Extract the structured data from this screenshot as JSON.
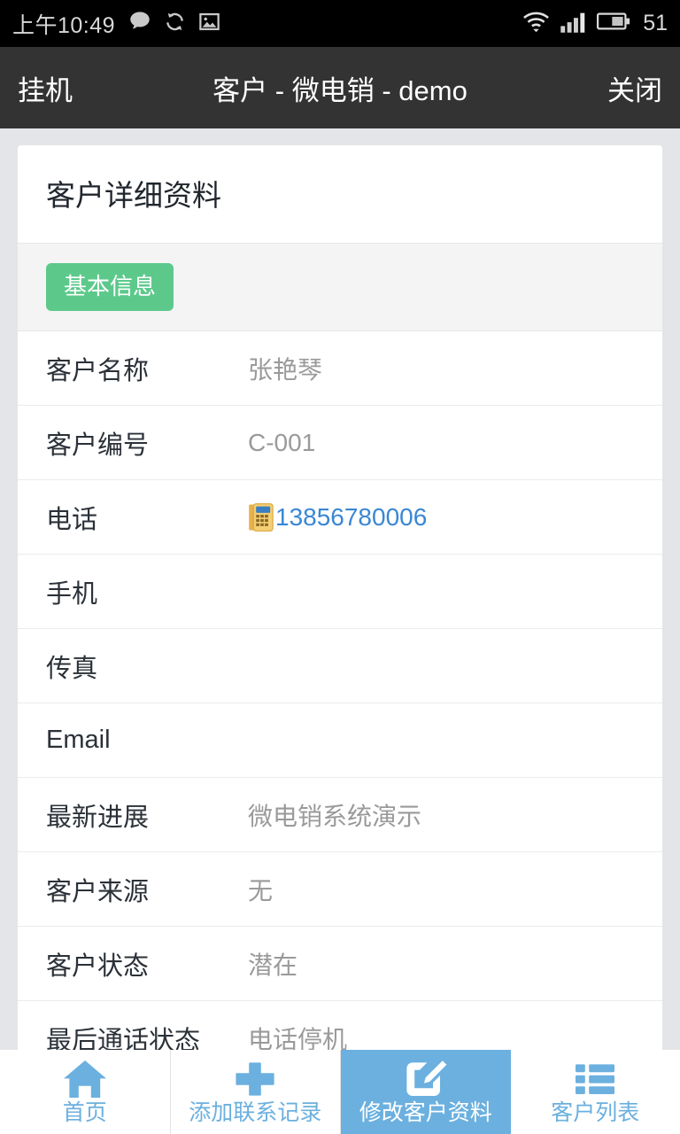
{
  "status_bar": {
    "time": "上午10:49",
    "battery_percent": "51",
    "icons": [
      "message-bubble-icon",
      "sync-icon",
      "image-icon",
      "wifi-icon",
      "signal-bars-icon",
      "battery-icon"
    ]
  },
  "title_bar": {
    "left_button": "挂机",
    "title": "客户 - 微电销 - demo",
    "right_button": "关闭"
  },
  "card": {
    "title": "客户详细资料",
    "section_badge": "基本信息",
    "badge_color": "#5cc98b",
    "rows": [
      {
        "label": "客户名称",
        "value": "张艳琴",
        "is_link": false,
        "has_phone_icon": false
      },
      {
        "label": "客户编号",
        "value": "C-001",
        "is_link": false,
        "has_phone_icon": false
      },
      {
        "label": "电话",
        "value": "13856780006",
        "is_link": true,
        "has_phone_icon": true
      },
      {
        "label": "手机",
        "value": "",
        "is_link": false,
        "has_phone_icon": false
      },
      {
        "label": "传真",
        "value": "",
        "is_link": false,
        "has_phone_icon": false
      },
      {
        "label": "Email",
        "value": "",
        "is_link": false,
        "has_phone_icon": false
      },
      {
        "label": "最新进展",
        "value": "微电销系统演示",
        "is_link": false,
        "has_phone_icon": false
      },
      {
        "label": "客户来源",
        "value": "无",
        "is_link": false,
        "has_phone_icon": false
      },
      {
        "label": "客户状态",
        "value": "潜在",
        "is_link": false,
        "has_phone_icon": false
      },
      {
        "label": "最后通话状态",
        "value": "电话停机",
        "is_link": false,
        "has_phone_icon": false
      }
    ]
  },
  "bottom_nav": {
    "accent_color": "#6bb0df",
    "items": [
      {
        "label": "首页",
        "icon": "home-icon",
        "active": false
      },
      {
        "label": "添加联系记录",
        "icon": "plus-icon",
        "active": false
      },
      {
        "label": "修改客户资料",
        "icon": "edit-square-icon",
        "active": true
      },
      {
        "label": "客户列表",
        "icon": "list-icon",
        "active": false
      }
    ]
  }
}
